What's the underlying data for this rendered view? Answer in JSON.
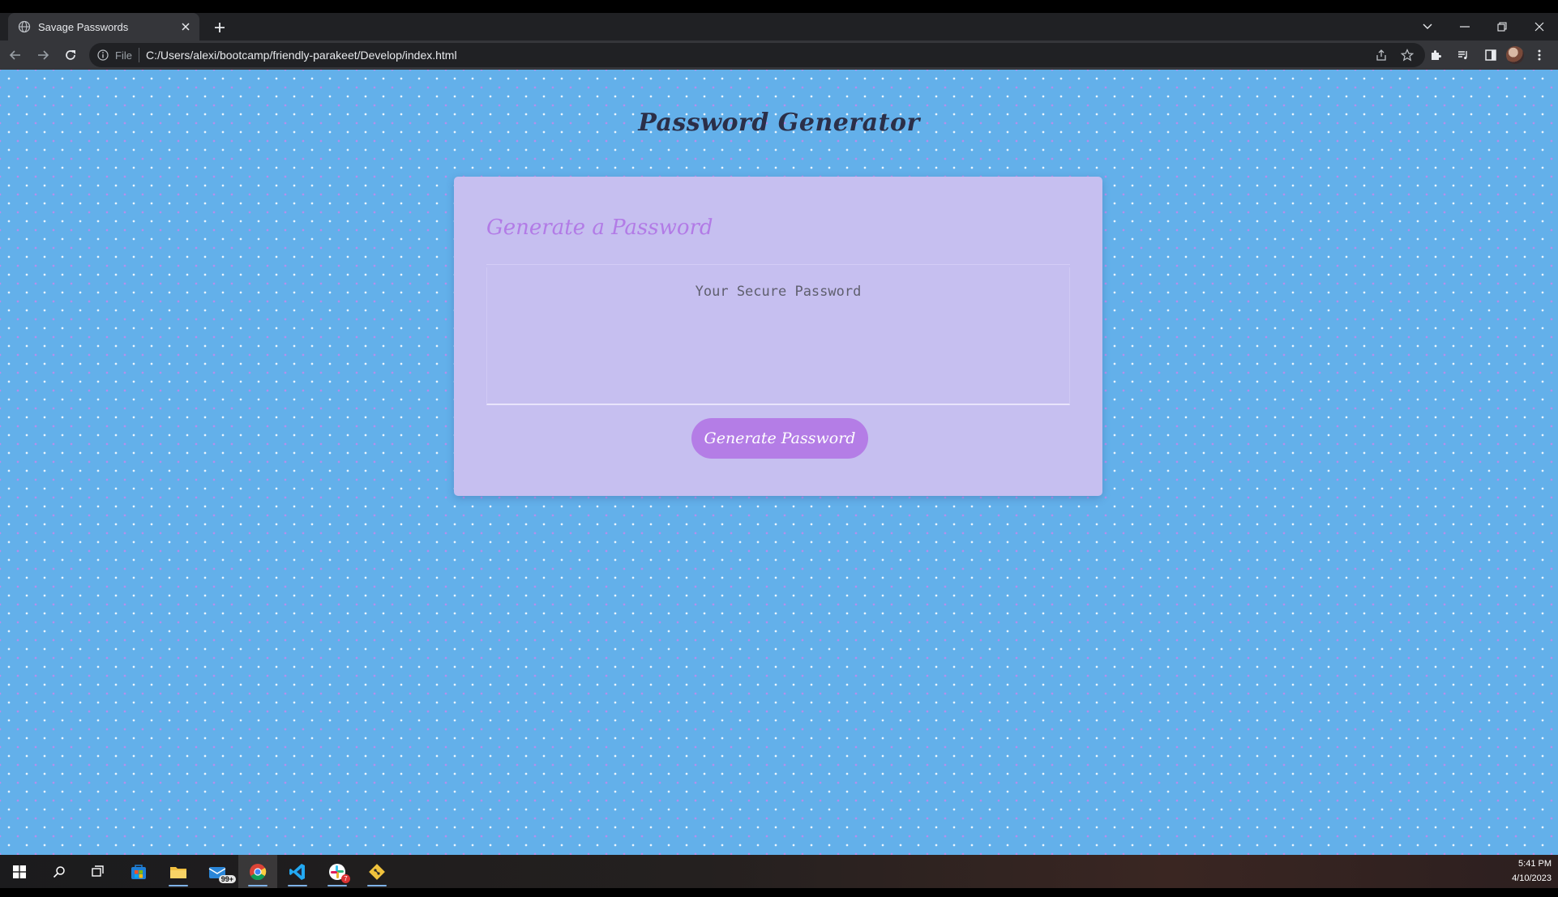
{
  "browser": {
    "tab_title": "Savage Passwords",
    "url_scheme": "File",
    "url": "C:/Users/alexi/bootcamp/friendly-parakeet/Develop/index.html"
  },
  "page": {
    "title": "Password Generator",
    "card_header": "Generate a Password",
    "password_placeholder": "Your Secure Password",
    "password_value": "",
    "generate_button_label": "Generate Password"
  },
  "colors": {
    "page_background": "#63b0ea",
    "card_background": "#c6bff0",
    "accent": "#b47de6",
    "title_text": "#2b2f48"
  },
  "taskbar": {
    "icons": [
      "windows-start-icon",
      "search-icon",
      "task-view-icon",
      "store-icon",
      "file-explorer-icon",
      "mail-icon",
      "chrome-icon",
      "vscode-icon",
      "slack-icon",
      "git-icon"
    ],
    "mail_badge": "99+",
    "slack_badge": "7",
    "time": "5:41 PM",
    "date": "4/10/2023"
  }
}
